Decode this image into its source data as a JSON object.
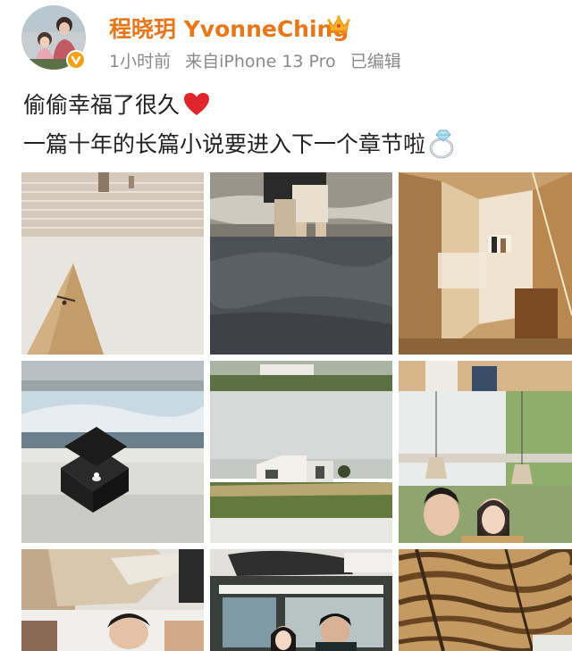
{
  "post": {
    "author": {
      "name": "程晓玥 YvonneChing"
    },
    "meta": {
      "time": "1小时前",
      "source": "来自iPhone 13 Pro",
      "edited": "已编辑"
    },
    "text": {
      "line1": "偷偷幸福了很久",
      "line2": "一篇十年的长篇小说要进入下一个章节啦"
    },
    "icons": {
      "verified": "verified-badge-icon",
      "crown": "crown-icon",
      "heart": "red-heart-emoji",
      "ring": "diamond-ring-emoji"
    },
    "colors": {
      "username": "#e8771a",
      "meta": "#8a8a8a",
      "text": "#222222",
      "verified": "#f3a117",
      "heart": "#e0242b"
    },
    "photos": [
      "staircase-and-white-tent-roof",
      "couple-on-beach-and-stormy-sky",
      "wooden-building-interior",
      "ring-box-by-the-sea",
      "white-house-on-lawn",
      "couple-under-pendant-lamps",
      "embrace-and-close-up",
      "couple-in-vehicle",
      "sand-dunes"
    ]
  }
}
